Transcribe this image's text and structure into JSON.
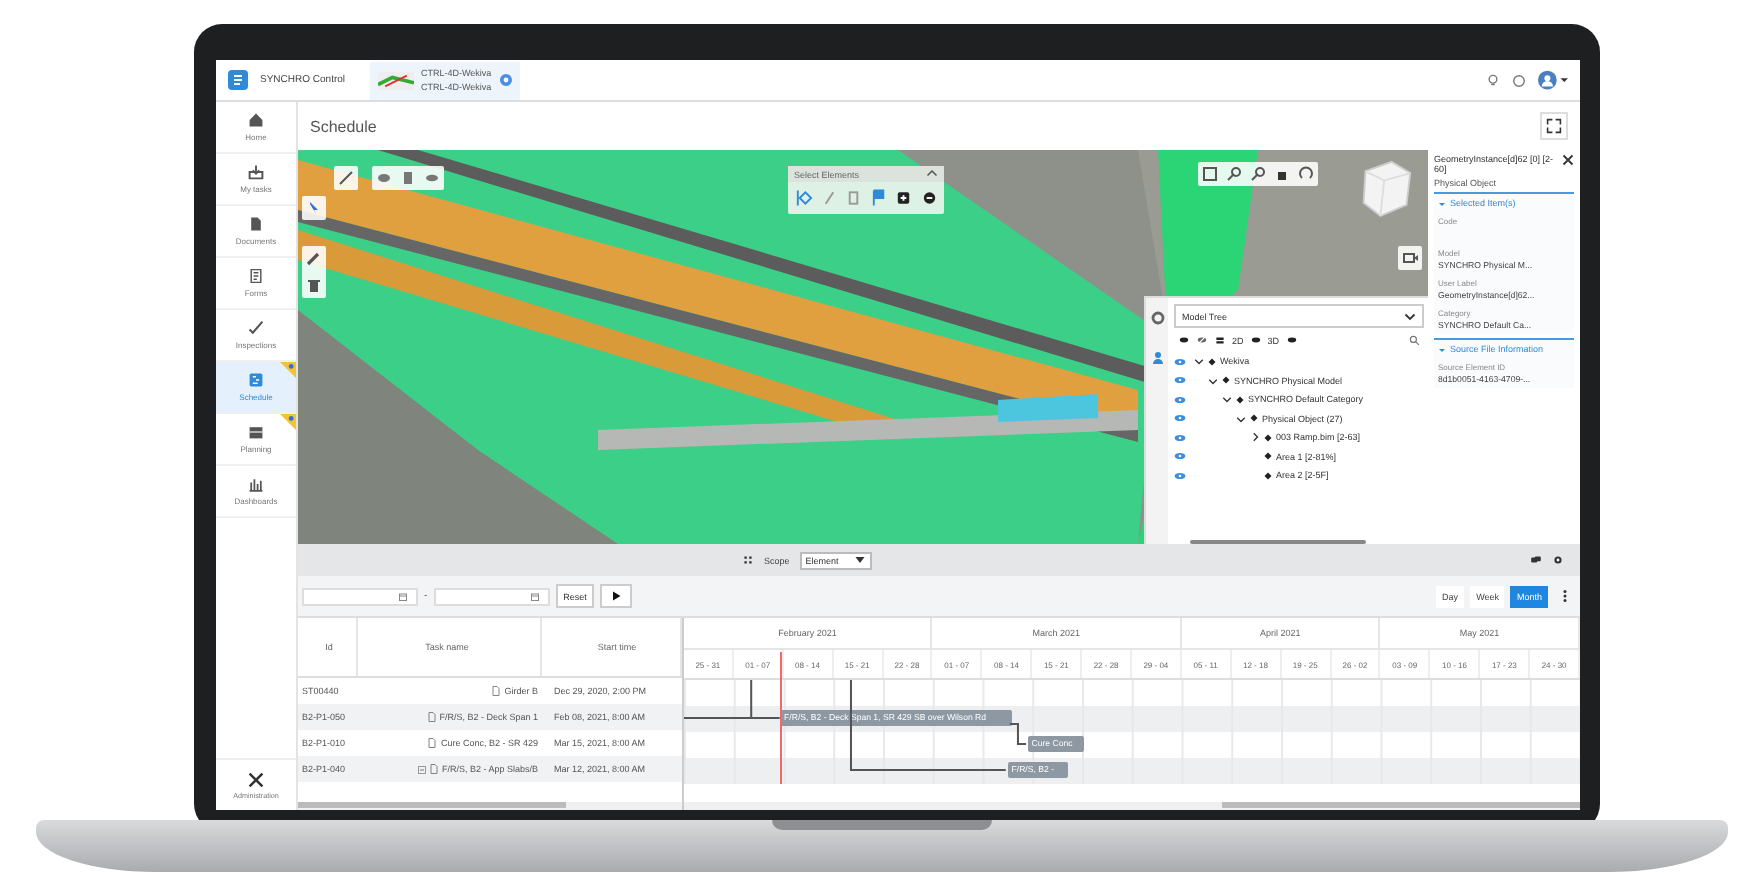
{
  "header": {
    "app_name": "SYNCHRO Control",
    "project_lines": [
      "CTRL-4D-Wekiva",
      "CTRL-4D-Wekiva"
    ]
  },
  "sidebar": {
    "items": [
      {
        "label": "Home",
        "selected": false,
        "flagged": false
      },
      {
        "label": "My tasks",
        "selected": false,
        "flagged": false
      },
      {
        "label": "Documents",
        "selected": false,
        "flagged": false
      },
      {
        "label": "Forms",
        "selected": false,
        "flagged": false
      },
      {
        "label": "Inspections",
        "selected": false,
        "flagged": false
      },
      {
        "label": "Schedule",
        "selected": true,
        "flagged": true
      },
      {
        "label": "Planning",
        "selected": false,
        "flagged": true
      },
      {
        "label": "Dashboards",
        "selected": false,
        "flagged": false
      }
    ],
    "footer": {
      "label": "Administration"
    }
  },
  "page_title": "Schedule",
  "select_elements": {
    "title": "Select Elements"
  },
  "model_tree": {
    "dropdown": "Model Tree",
    "view_labels": [
      "2D",
      "3D"
    ],
    "nodes": [
      {
        "label": "Wekiva",
        "expanded": true,
        "children": [
          {
            "label": "SYNCHRO Physical Model",
            "expanded": true,
            "children": [
              {
                "label": "SYNCHRO Default Category",
                "expanded": true,
                "children": [
                  {
                    "label": "Physical Object (27)",
                    "expanded": true,
                    "children": [
                      {
                        "label": "003 Ramp.bim [2-63]",
                        "expanded": false
                      },
                      {
                        "label": "Area 1 [2-81%]"
                      },
                      {
                        "label": "Area 2 [2-5F]"
                      }
                    ]
                  }
                ]
              }
            ]
          }
        ]
      }
    ]
  },
  "properties": {
    "title": "GeometryInstance[d]62 [0] [2-60]",
    "subtitle": "Physical Object",
    "sections": [
      {
        "title": "Selected Item(s)",
        "expanded": true,
        "fields": [
          {
            "label": "Code"
          },
          {
            "label": "Model",
            "value": "SYNCHRO Physical M..."
          },
          {
            "label": "User Label",
            "value": "GeometryInstance[d]62..."
          },
          {
            "label": "Category",
            "value": "SYNCHRO Default Ca..."
          }
        ]
      },
      {
        "title": "Source File Information",
        "expanded": true,
        "fields": [
          {
            "label": "Source Element ID",
            "value": "8d1b0051-4163-4709-..."
          }
        ]
      }
    ]
  },
  "scope": {
    "label": "Scope",
    "value": "Element"
  },
  "gantt": {
    "separator": "-",
    "reset": "Reset",
    "views": [
      {
        "label": "Day",
        "selected": false
      },
      {
        "label": "Week",
        "selected": false
      },
      {
        "label": "Month",
        "selected": true
      }
    ],
    "columns": [
      "Id",
      "Task name",
      "Start time"
    ],
    "months": [
      "February 2021",
      "March 2021",
      "April 2021",
      "May 2021"
    ],
    "weeks": [
      "25 - 31",
      "01 - 07",
      "08 - 14",
      "15 - 21",
      "22 - 28",
      "01 - 07",
      "08 - 14",
      "15 - 21",
      "22 - 28",
      "29 - 04",
      "05 - 11",
      "12 - 18",
      "19 - 25",
      "26 - 02",
      "03 - 09",
      "10 - 16",
      "17 - 23",
      "24 - 30"
    ],
    "rows": [
      {
        "id": "ST00440",
        "task": "Girder B",
        "start": "Dec 29, 2020, 2:00 PM"
      },
      {
        "id": "B2-P1-050",
        "task": "F/R/S, B2 - Deck Span 1",
        "start": "Feb 08, 2021, 8:00 AM",
        "bar": "F/R/S, B2 - Deck Span 1, SR 429 SB over Wilson Rd"
      },
      {
        "id": "B2-P1-010",
        "task": "Cure Conc, B2 - SR 429",
        "start": "Mar 15, 2021, 8:00 AM",
        "bar": "Cure Conc"
      },
      {
        "id": "B2-P1-040",
        "task": "F/R/S, B2 - App Slabs/B",
        "start": "Mar 12, 2021, 8:00 AM",
        "bar": "F/R/S, B2 -",
        "expanded": true
      }
    ]
  }
}
